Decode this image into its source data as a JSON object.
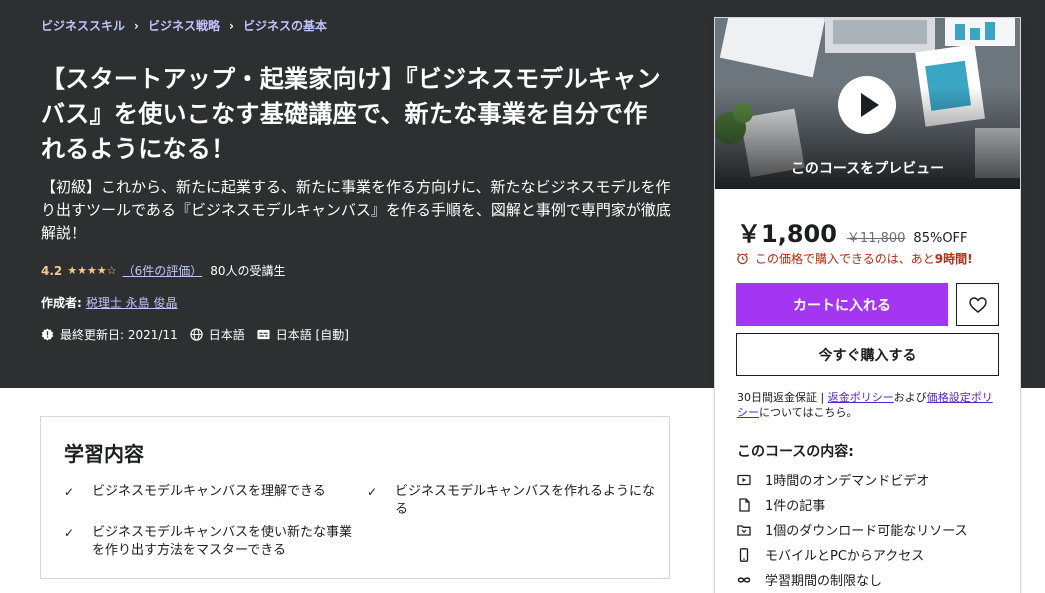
{
  "breadcrumb": {
    "items": [
      "ビジネススキル",
      "ビジネス戦略",
      "ビジネスの基本"
    ],
    "separator": "›"
  },
  "course": {
    "title": "【スタートアップ・起業家向け】『ビジネスモデルキャンバス』を使いこなす基礎講座で、新たな事業を自分で作れるようになる！",
    "subtitle": "【初級】これから、新たに起業する、新たに事業を作る方向けに、新たなビジネスモデルを作り出すツールである『ビジネスモデルキャンバス』を作る手順を、図解と事例で専門家が徹底解説！",
    "rating_value": "4.2",
    "stars": "★★★★☆",
    "rating_count": "（6件の評価）",
    "students": "80人の受講生",
    "author_label": "作成者:",
    "author_name": "税理士 永島 俊晶",
    "updated": "最終更新日: 2021/11",
    "language": "日本語",
    "captions": "日本語 [自動]"
  },
  "sidebar": {
    "preview_label": "このコースをプレビュー",
    "price": "￥1,800",
    "original_price": "￥11,800",
    "discount": "85%OFF",
    "timer_text": "この価格で購入できるのは、あと",
    "timer_bold": "9時間!",
    "cart_button": "カートに入れる",
    "buy_button": "今すぐ購入する",
    "guarantee_prefix": "30日間返金保証 | ",
    "refund_policy": "返金ポリシー",
    "and": "および",
    "pricing_policy": "価格設定ポリシー",
    "guarantee_suffix": "についてはこちら。",
    "includes_title": "このコースの内容:",
    "includes": [
      {
        "icon": "video-icon",
        "label": "1時間のオンデマンドビデオ"
      },
      {
        "icon": "article-icon",
        "label": "1件の記事"
      },
      {
        "icon": "download-icon",
        "label": "1個のダウンロード可能なリソース"
      },
      {
        "icon": "mobile-icon",
        "label": "モバイルとPCからアクセス"
      },
      {
        "icon": "infinity-icon",
        "label": "学習期間の制限なし"
      }
    ]
  },
  "learn": {
    "title": "学習内容",
    "items": [
      "ビジネスモデルキャンバスを理解できる",
      "ビジネスモデルキャンバスを作れるようになる",
      "ビジネスモデルキャンバスを使い新たな事業を作り出す方法をマスターできる"
    ]
  },
  "colors": {
    "hero_bg": "#2d2f31",
    "accent_purple": "#a435f0",
    "link_purple": "#c0c4fc",
    "star": "#f3ca8c",
    "timer_red": "#b32d0f"
  }
}
